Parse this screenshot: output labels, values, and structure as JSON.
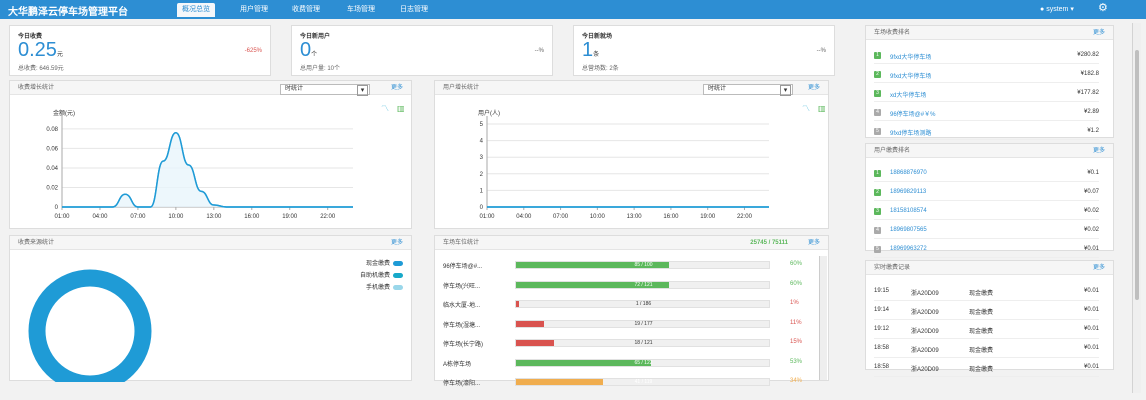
{
  "app": {
    "title": "大华鹏泽云停车场管理平台",
    "tabs": [
      "概况总览",
      "用户管理",
      "收费管理",
      "车场管理",
      "日志管理"
    ],
    "user": "system"
  },
  "stats": [
    {
      "title": "今日收费",
      "value": "0.25",
      "unit": "元",
      "change": "-625%",
      "sub": "总收费: 646.59元"
    },
    {
      "title": "今日新用户",
      "value": "0",
      "unit": "个",
      "change": "--%",
      "sub": "总用户量: 10个"
    },
    {
      "title": "今日新就场",
      "value": "1",
      "unit": "条",
      "change": "--%",
      "sub": "总营场数: 2条"
    }
  ],
  "revenue_chart": {
    "title": "收费增长统计",
    "select": "时统计",
    "more": "更多"
  },
  "user_chart": {
    "title": "用户增长统计",
    "select": "时统计",
    "more": "更多"
  },
  "donut": {
    "title": "收费来源统计",
    "more": "更多",
    "legend": [
      "现金缴费",
      "自助机缴费",
      "手机缴费"
    ]
  },
  "lots": {
    "title": "车场车位统计",
    "summary": "25745 / 75111",
    "more": "更多",
    "rows": [
      {
        "name": "96停车场@#...",
        "used_label": "85 / 100",
        "pct": "60%"
      },
      {
        "name": "停车场(兴旺...",
        "used_label": "72 / 121",
        "pct": "60%"
      },
      {
        "name": "临水大厦-地...",
        "used_label": "1 / 186",
        "pct": "1%"
      },
      {
        "name": "停车场(湿塘...",
        "used_label": "19 / 177",
        "pct": "11%"
      },
      {
        "name": "停车场(长宁路)",
        "used_label": "18 / 121",
        "pct": "15%"
      },
      {
        "name": "A栋停车场",
        "used_label": "65 / 122",
        "pct": "53%"
      },
      {
        "name": "停车场(濠阳...",
        "used_label": "41 / 119",
        "pct": "34%"
      }
    ]
  },
  "rank_lot": {
    "title": "车场收费排名",
    "more": "更多",
    "items": [
      {
        "rank": "1",
        "name": "9fxd大华停车场",
        "value": "¥280.82"
      },
      {
        "rank": "2",
        "name": "9fxd大华停车场",
        "value": "¥182.8"
      },
      {
        "rank": "3",
        "name": "xd大华停车场",
        "value": "¥177.82"
      },
      {
        "rank": "4",
        "name": "96停车场@#￥%",
        "value": "¥2.89"
      },
      {
        "rank": "5",
        "name": "9fxd停车场测路",
        "value": "¥1.2"
      }
    ]
  },
  "rank_user": {
    "title": "用户缴费排名",
    "more": "更多",
    "items": [
      {
        "rank": "1",
        "name": "18868876970",
        "value": "¥0.1"
      },
      {
        "rank": "2",
        "name": "18969829113",
        "value": "¥0.07"
      },
      {
        "rank": "3",
        "name": "18158108574",
        "value": "¥0.02"
      },
      {
        "rank": "4",
        "name": "18969807565",
        "value": "¥0.02"
      },
      {
        "rank": "5",
        "name": "18969963272",
        "value": "¥0.01"
      }
    ]
  },
  "records": {
    "title": "实时缴费记录",
    "more": "更多",
    "items": [
      {
        "time": "19:15",
        "plate": "浙A20D09",
        "type": "现金缴费",
        "amount": "¥0.01"
      },
      {
        "time": "19:14",
        "plate": "浙A20D09",
        "type": "现金缴费",
        "amount": "¥0.01"
      },
      {
        "time": "19:12",
        "plate": "浙A20D09",
        "type": "现金缴费",
        "amount": "¥0.01"
      },
      {
        "time": "18:58",
        "plate": "浙A20D09",
        "type": "现金缴费",
        "amount": "¥0.01"
      },
      {
        "time": "18:58",
        "plate": "浙A20D09",
        "type": "现金缴费",
        "amount": "¥0.01"
      }
    ]
  },
  "chart_data": [
    {
      "type": "area",
      "title": "",
      "ylabel": "金额(元)",
      "x": [
        "01:00",
        "04:00",
        "07:00",
        "10:00",
        "13:00",
        "16:00",
        "19:00",
        "22:00"
      ],
      "y_ticks": [
        "0",
        "0.02",
        "0.04",
        "0.06",
        "0.08"
      ],
      "ylim": [
        0,
        0.085
      ],
      "series": [
        {
          "name": "",
          "values": [
            0,
            0,
            0,
            0,
            0,
            0.013,
            0,
            0,
            0.047,
            0.076,
            0.043,
            0.016,
            0.002,
            0,
            0,
            0,
            0,
            0,
            0,
            0,
            0,
            0,
            0,
            0
          ]
        }
      ],
      "grid": true
    },
    {
      "type": "line",
      "title": "",
      "ylabel": "用户(人)",
      "x": [
        "01:00",
        "04:00",
        "07:00",
        "10:00",
        "13:00",
        "16:00",
        "19:00",
        "22:00"
      ],
      "y_ticks": [
        "0",
        "1",
        "2",
        "3",
        "4",
        "5"
      ],
      "ylim": [
        0,
        5
      ],
      "series": [
        {
          "name": "",
          "values": [
            0,
            0,
            0,
            0,
            0,
            0,
            0,
            0,
            0,
            0,
            0,
            0,
            0,
            0,
            0,
            0,
            0,
            0,
            0,
            0,
            0,
            0,
            0,
            0
          ]
        }
      ],
      "grid": true
    },
    {
      "type": "pie",
      "title": "",
      "categories": [
        "现金缴费",
        "自助机缴费",
        "手机缴费"
      ],
      "values": [
        100,
        0,
        0
      ],
      "legend": "top-right"
    },
    {
      "type": "bar",
      "title": "",
      "categories": [
        "96停车场@#...",
        "停车场(兴旺...",
        "临水大厦-地...",
        "停车场(湿塘...",
        "停车场(长宁路)",
        "A栋停车场",
        "停车场(濠阳..."
      ],
      "values": [
        60,
        60,
        1,
        11,
        15,
        53,
        34
      ],
      "xlim": [
        0,
        100
      ]
    }
  ]
}
